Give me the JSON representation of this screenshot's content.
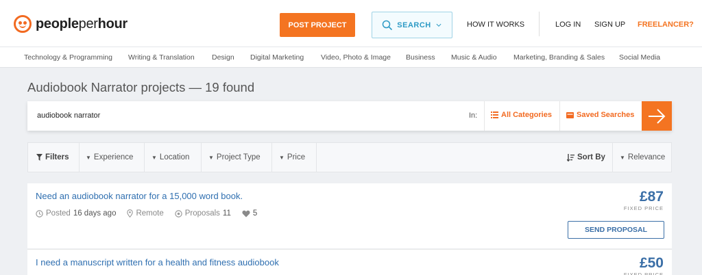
{
  "brand": {
    "part1": "people",
    "part2": "per",
    "part3": "hour",
    "color": "#f26a21"
  },
  "header": {
    "post_project": "POST PROJECT",
    "search": "SEARCH",
    "how_it_works": "HOW IT WORKS",
    "log_in": "LOG IN",
    "sign_up": "SIGN UP",
    "freelancer": "FREELANCER?"
  },
  "categories": [
    "Technology & Programming",
    "Writing & Translation",
    "Design",
    "Digital Marketing",
    "Video, Photo & Image",
    "Business",
    "Music & Audio",
    "Marketing, Branding & Sales",
    "Social Media"
  ],
  "page_title": "Audiobook Narrator projects — 19 found",
  "search": {
    "query": "audiobook narrator",
    "in_label": "In:",
    "all_categories": "All Categories",
    "saved_searches": "Saved Searches"
  },
  "filters": {
    "filters_label": "Filters",
    "experience": "Experience",
    "location": "Location",
    "project_type": "Project Type",
    "price": "Price",
    "sort_by": "Sort By",
    "relevance": "Relevance"
  },
  "results": [
    {
      "title": "Need an audiobook narrator for a 15,000 word book.",
      "posted_label": "Posted",
      "posted_value": "16 days ago",
      "location": "Remote",
      "proposals_label": "Proposals",
      "proposals_value": "11",
      "likes": "5",
      "price": "£87",
      "price_type": "FIXED PRICE",
      "action": "SEND PROPOSAL"
    },
    {
      "title": "I need a manuscript written for a health and fitness audiobook",
      "price": "£50",
      "price_type": "FIXED PRICE"
    }
  ],
  "colors": {
    "accent": "#f47421",
    "link": "#2f6fb0",
    "price": "#3b6fa7",
    "search_teal": "#2d9ac5"
  }
}
